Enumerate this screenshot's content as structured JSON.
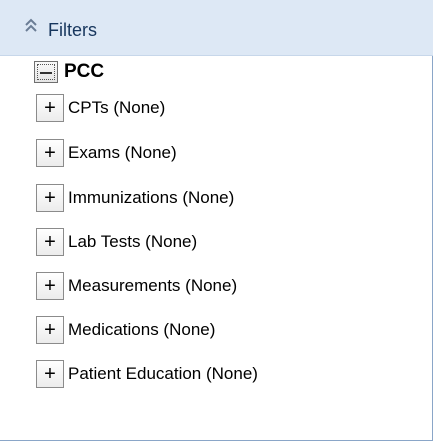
{
  "header": {
    "title": "Filters",
    "collapse_icon": "double-chevron-up-icon"
  },
  "tree": {
    "root": {
      "label": "PCC",
      "expanded": true
    },
    "expand_glyph": "+",
    "items": [
      {
        "label": "CPTs (None)"
      },
      {
        "label": "Exams (None)"
      },
      {
        "label": "Immunizations (None)"
      },
      {
        "label": "Lab Tests (None)"
      },
      {
        "label": "Measurements (None)"
      },
      {
        "label": "Medications (None)"
      },
      {
        "label": "Patient Education (None)"
      }
    ]
  },
  "colors": {
    "header_background": "#dde8f5",
    "header_text": "#17365d",
    "panel_border": "#8aa6c8"
  }
}
